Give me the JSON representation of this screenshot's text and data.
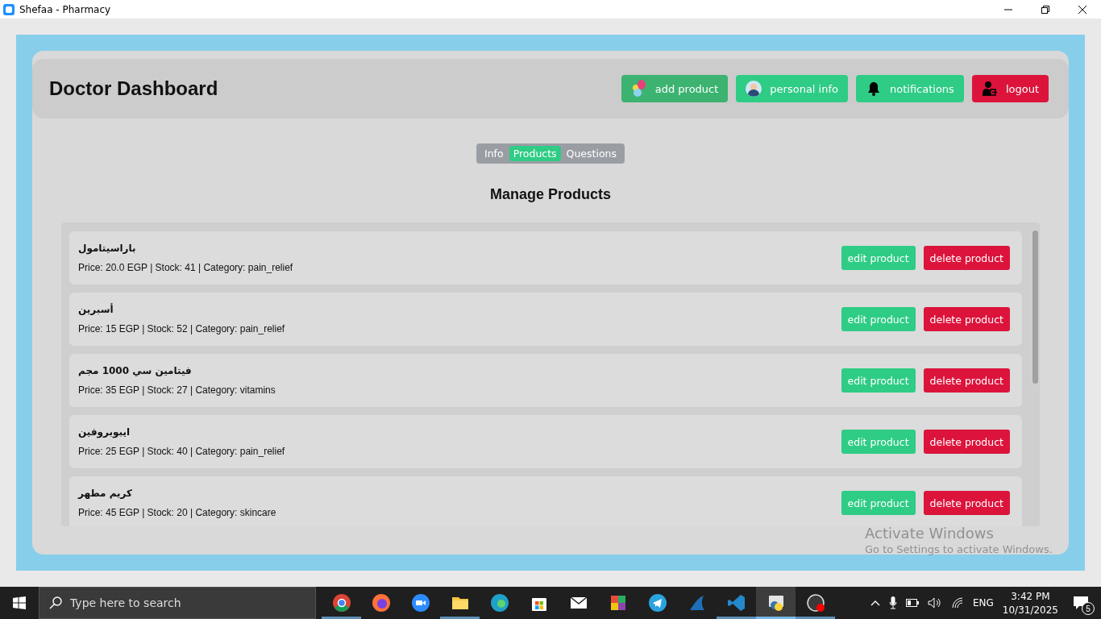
{
  "window": {
    "title": "Shefaa - Pharmacy"
  },
  "header": {
    "title": "Doctor Dashboard",
    "buttons": [
      {
        "label": "add product",
        "kind": "add"
      },
      {
        "label": "personal info",
        "kind": "profile"
      },
      {
        "label": "notifications",
        "kind": "notify"
      },
      {
        "label": "logout",
        "kind": "logout"
      }
    ]
  },
  "tabs": [
    {
      "label": "Info",
      "selected": false
    },
    {
      "label": "Products",
      "selected": true
    },
    {
      "label": "Questions",
      "selected": false
    }
  ],
  "section_title": "Manage Products",
  "products": [
    {
      "name": "باراسيتامول",
      "details": "Price: 20.0 EGP | Stock: 41 | Category: pain_relief",
      "edit": "edit product",
      "delete": "delete product"
    },
    {
      "name": "أسبرين",
      "details": "Price: 15 EGP | Stock: 52 | Category: pain_relief",
      "edit": "edit product",
      "delete": "delete product"
    },
    {
      "name": "فيتامين سي 1000 مجم",
      "details": "Price: 35 EGP | Stock: 27 | Category: vitamins",
      "edit": "edit product",
      "delete": "delete product"
    },
    {
      "name": "ايبوبروفين",
      "details": "Price: 25 EGP | Stock: 40 | Category: pain_relief",
      "edit": "edit product",
      "delete": "delete product"
    },
    {
      "name": "كريم مطهر",
      "details": "Price: 45 EGP | Stock: 20 | Category: skincare",
      "edit": "edit product",
      "delete": "delete product"
    }
  ],
  "activation_notice": {
    "title": "Activate Windows",
    "subtitle": "Go to Settings to activate Windows."
  },
  "taskbar": {
    "search_placeholder": "Type here to search",
    "apps": [
      {
        "kind": "chrome",
        "running": true,
        "selected": false
      },
      {
        "kind": "firefox",
        "running": false,
        "selected": false
      },
      {
        "kind": "zoom",
        "running": false,
        "selected": false
      },
      {
        "kind": "folder",
        "running": true,
        "selected": false
      },
      {
        "kind": "edge",
        "running": false,
        "selected": false
      },
      {
        "kind": "store",
        "running": false,
        "selected": false
      },
      {
        "kind": "mail",
        "running": false,
        "selected": false
      },
      {
        "kind": "office",
        "running": false,
        "selected": false
      },
      {
        "kind": "telegram",
        "running": false,
        "selected": false
      },
      {
        "kind": "shark",
        "running": false,
        "selected": false
      },
      {
        "kind": "vscode",
        "running": true,
        "selected": false
      },
      {
        "kind": "python",
        "running": true,
        "selected": true
      },
      {
        "kind": "obs",
        "running": true,
        "selected": false
      }
    ],
    "language": "ENG",
    "time": "3:42 PM",
    "date": "10/31/2025",
    "notification_count": "5"
  }
}
